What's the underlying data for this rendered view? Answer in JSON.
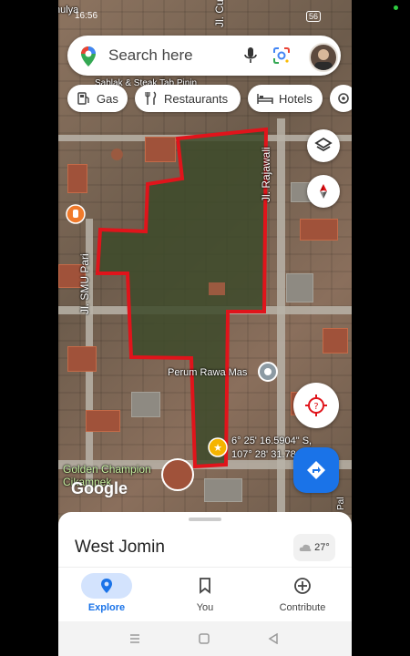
{
  "status_bar": {
    "time": "16:56",
    "battery": "56"
  },
  "search": {
    "placeholder": "Search here"
  },
  "chips": [
    {
      "label": "Gas",
      "icon": "gas-station-icon"
    },
    {
      "label": "Restaurants",
      "icon": "fork-knife-icon"
    },
    {
      "label": "Hotels",
      "icon": "bed-icon"
    }
  ],
  "map": {
    "road_labels": [
      "Jl. Rajawali",
      "Jl. SMU Pari",
      "Jl. Cu"
    ],
    "poi_labels": [
      "Perum Rawa Mas",
      "Golden Champion\nCikampek",
      "Sablak & Steak Tab Pinin",
      "Pal"
    ],
    "coordinates": [
      "6° 25' 16.5904\" S,",
      "107° 28' 31.78"
    ],
    "corner_text": "nulya",
    "watermark": "Google"
  },
  "sheet": {
    "place_name": "West Jomin",
    "temperature": "27°"
  },
  "bottom_nav": [
    {
      "label": "Explore",
      "icon": "location-pin-icon",
      "active": true
    },
    {
      "label": "You",
      "icon": "bookmark-icon",
      "active": false
    },
    {
      "label": "Contribute",
      "icon": "plus-circle-icon",
      "active": false
    }
  ],
  "colors": {
    "accent": "#1a73e8",
    "parcel_outline": "#e0141b",
    "directions_fab": "#1a73e8"
  }
}
